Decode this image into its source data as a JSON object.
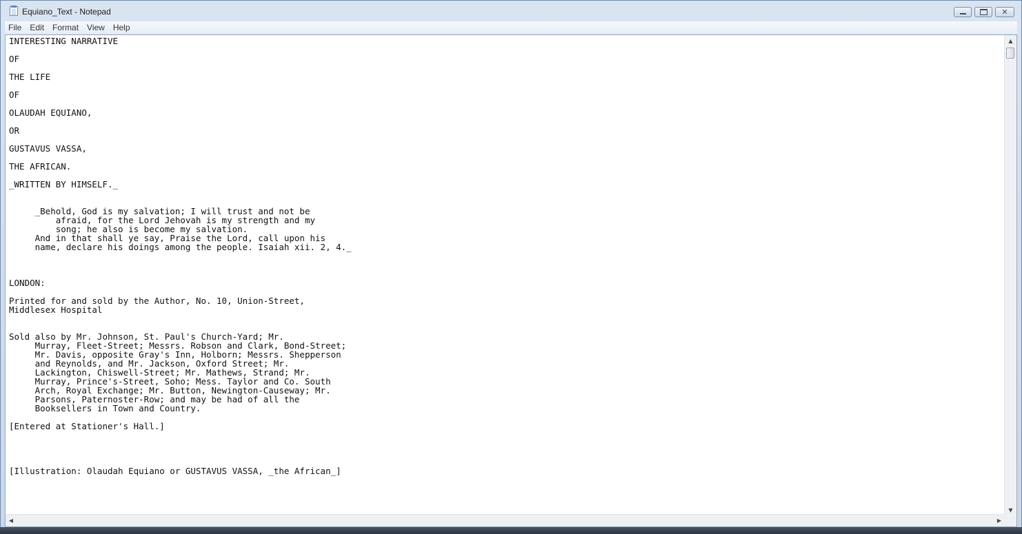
{
  "window": {
    "title": "Equiano_Text - Notepad",
    "buttons": {
      "minimize_icon": "minimize-icon",
      "maximize_icon": "restore-icon",
      "close_icon": "close-icon"
    }
  },
  "menubar": {
    "items": [
      "File",
      "Edit",
      "Format",
      "View",
      "Help"
    ]
  },
  "document": {
    "content": "INTERESTING NARRATIVE\n\nOF\n\nTHE LIFE\n\nOF\n\nOLAUDAH EQUIANO,\n\nOR\n\nGUSTAVUS VASSA,\n\nTHE AFRICAN.\n\n_WRITTEN BY HIMSELF._\n\n\n     _Behold, God is my salvation; I will trust and not be\n         afraid, for the Lord Jehovah is my strength and my\n         song; he also is become my salvation.\n     And in that shall ye say, Praise the Lord, call upon his\n     name, declare his doings among the people. Isaiah xii. 2, 4._\n\n\n\nLONDON:\n\nPrinted for and sold by the Author, No. 10, Union-Street,\nMiddlesex Hospital\n\n\nSold also by Mr. Johnson, St. Paul's Church-Yard; Mr.\n     Murray, Fleet-Street; Messrs. Robson and Clark, Bond-Street;\n     Mr. Davis, opposite Gray's Inn, Holborn; Messrs. Shepperson\n     and Reynolds, and Mr. Jackson, Oxford Street; Mr.\n     Lackington, Chiswell-Street; Mr. Mathews, Strand; Mr.\n     Murray, Prince's-Street, Soho; Mess. Taylor and Co. South\n     Arch, Royal Exchange; Mr. Button, Newington-Causeway; Mr.\n     Parsons, Paternoster-Row; and may be had of all the\n     Booksellers in Town and Country.\n\n[Entered at Stationer's Hall.]\n\n\n\n\n[Illustration: Olaudah Equiano or GUSTAVUS VASSA, _the African_]"
  }
}
